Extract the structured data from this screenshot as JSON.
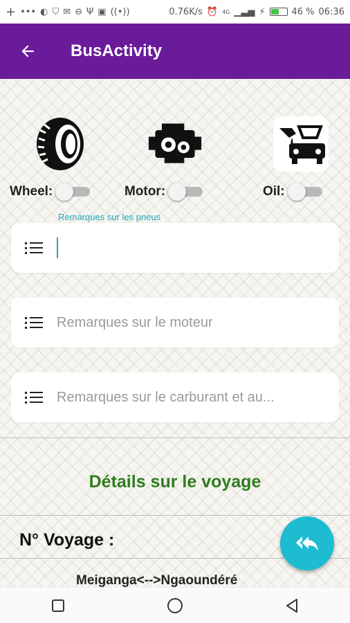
{
  "status_bar": {
    "left_icons": [
      "plus-icon",
      "more-icon",
      "app-icon",
      "shield-icon",
      "mail-icon",
      "minus-icon",
      "usb-icon",
      "image-icon",
      "hotspot-icon"
    ],
    "speed": "0.76K/s",
    "signal": "4G",
    "battery_level": 0.46,
    "battery": "46 %",
    "time": "06:36"
  },
  "app_bar": {
    "title": "BusActivity",
    "back_icon": "arrow-back-icon",
    "color": "#6a1b9a"
  },
  "status_items": [
    {
      "label": "Wheel:",
      "icon": "tire-icon",
      "on": false
    },
    {
      "label": "Motor:",
      "icon": "engine-icon",
      "on": false
    },
    {
      "label": "Oil:",
      "icon": "oil-car-icon",
      "on": false
    }
  ],
  "fields": {
    "wheel_remarks": {
      "floating_label": "Remarques sur les pneus",
      "value": ""
    },
    "motor_remarks": {
      "placeholder": "Remarques sur le moteur"
    },
    "fuel_remarks": {
      "placeholder": "Remarques sur le carburant et au..."
    }
  },
  "trip": {
    "section_title": "Détails sur le voyage",
    "voyage_label": "N° Voyage :",
    "route": "Meiganga<-->Ngaoundéré"
  },
  "fab": {
    "icon": "reply-all-icon",
    "color": "#1ebcd0"
  },
  "nav_bar": {
    "buttons": [
      "recent-apps-icon",
      "home-icon",
      "back-icon"
    ]
  }
}
